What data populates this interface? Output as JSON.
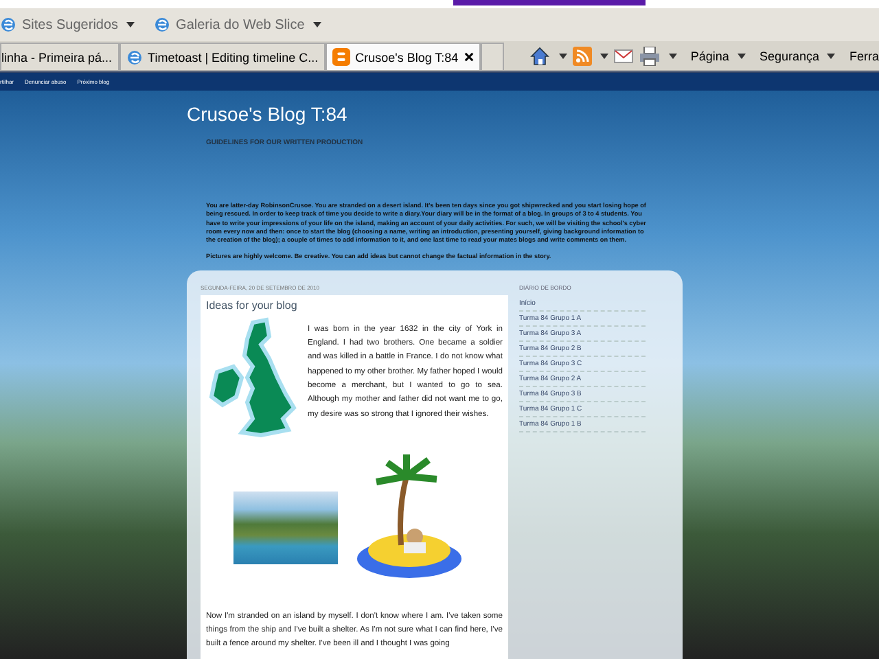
{
  "favorites_bar": [
    {
      "label": "Sites Sugeridos"
    },
    {
      "label": "Galeria do Web Slice"
    }
  ],
  "tabs": [
    {
      "label": "linha - Primeira pá...",
      "kind": "plain",
      "selected": false
    },
    {
      "label": "Timetoast | Editing timeline C...",
      "kind": "ie",
      "selected": false
    },
    {
      "label": "Crusoe's Blog T:84",
      "kind": "blogger",
      "selected": true
    }
  ],
  "command_bar": [
    {
      "label": "Página"
    },
    {
      "label": "Segurança"
    },
    {
      "label": "Ferra"
    }
  ],
  "navbar": [
    "rtilhar",
    "Denunciar abuso",
    "Próximo blog"
  ],
  "blog": {
    "title": "Crusoe's Blog T:84",
    "subtitle": "GUIDELINES FOR OUR WRITTEN PRODUCTION",
    "description": [
      "You are latter-day RobinsonCrusoe. You are stranded on a desert island. It's been ten days since you got shipwrecked and you start losing hope of being rescued. In order to keep track of time you decide to write a diary.Your diary will be in the format of a blog. In groups of 3 to 4 students. You have to write your impressions of your life on the island, making an account of your daily activities. For such, we will be visiting the school's cyber room every now and then: once to start the blog (choosing a name, writing an introduction, presenting yourself, giving background information to the creation of the blog); a couple of times to add information to it, and one last time to read your mates blogs and write comments on them.",
      "Pictures are highly welcome. Be creative. You can add ideas but cannot change the factual information in the story."
    ]
  },
  "post": {
    "date": "SEGUNDA-FEIRA, 20 DE SETEMBRO DE 2010",
    "title": "Ideas for your blog",
    "paragraph_1": "I was born in the year 1632 in the city of York in England. I had two brothers. One became a soldier and was killed in a battle in France. I do not know what happened to my other brother. My father hoped I would become a merchant, but I wanted to go to sea. Although my mother and father did not want me to go, my desire was so strong that I ignored their wishes.",
    "paragraph_2": "Now I'm stranded on an island by myself. I don't know where I am. I've taken some things from the ship and I've built a shelter. As I'm not sure what I can find here, I've built a fence around my shelter. I've been ill and I thought I was going"
  },
  "sidebar": {
    "heading": "DIÁRIO DE BORDO",
    "links": [
      "Início",
      "Turma 84 Grupo 1 A",
      "Turma 84 Grupo 3 A",
      "Turma 84 Grupo 2 B",
      "Turma 84 Grupo 3 C",
      "Turma 84 Grupo 2 A",
      "Turma 84 Grupo 3 B",
      "Turma 84 Grupo 1 C",
      "Turma 84 Grupo 1 B"
    ]
  }
}
